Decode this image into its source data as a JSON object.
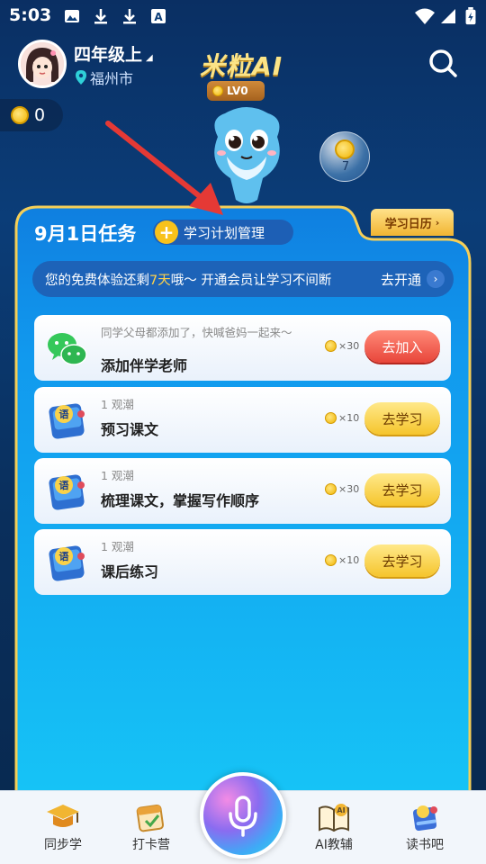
{
  "status_bar": {
    "time": "5:03",
    "icons": [
      "image-icon",
      "download-icon",
      "download-icon",
      "font-icon",
      "wifi-icon",
      "signal-icon",
      "battery-charging-icon"
    ]
  },
  "header": {
    "grade": "四年级上",
    "city": "福州市",
    "app_title": "米粒AI"
  },
  "coins": {
    "count": "0"
  },
  "mascot": {
    "level": "LV0",
    "bubble_count": "7"
  },
  "panel": {
    "title": "9月1日任务",
    "plan_label": "学习计划管理",
    "calendar_label": "学习日历",
    "promo": {
      "prefix": "您的免费体验还剩",
      "days": "7天",
      "suffix": "哦～ 开通会员让学习不间断",
      "link": "去开通"
    },
    "tasks": [
      {
        "subtitle": "同学父母都添加了，快喊爸妈一起来～",
        "name": "添加伴学老师",
        "reward": "×30",
        "button": "去加入"
      },
      {
        "subtitle": "1 观潮",
        "name": "预习课文",
        "reward": "×10",
        "button": "去学习"
      },
      {
        "subtitle": "1 观潮",
        "name": "梳理课文，掌握写作顺序",
        "reward": "×30",
        "button": "去学习"
      },
      {
        "subtitle": "1 观潮",
        "name": "课后练习",
        "reward": "×10",
        "button": "去学习"
      }
    ]
  },
  "bottom_nav": {
    "items": [
      {
        "label": "同步学"
      },
      {
        "label": "打卡营"
      },
      {
        "label": "AI教辅"
      },
      {
        "label": "读书吧"
      }
    ]
  },
  "colors": {
    "accent_yellow": "#f5c52c",
    "accent_red": "#e8453a",
    "panel_blue": "#139bf0"
  }
}
